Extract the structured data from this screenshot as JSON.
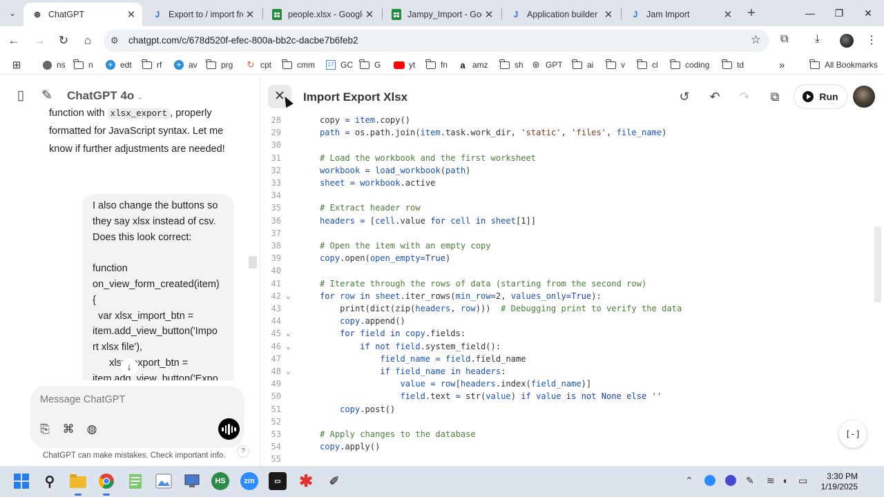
{
  "browser": {
    "tabs": [
      {
        "title": "ChatGPT",
        "icon": "chatgpt-icon",
        "active": true
      },
      {
        "title": "Export to / import fro",
        "icon": "jira-icon",
        "active": false
      },
      {
        "title": "people.xlsx - Google",
        "icon": "sheets-icon",
        "active": false
      },
      {
        "title": "Jampy_Import - Goo",
        "icon": "sheets-icon",
        "active": false
      },
      {
        "title": "Application builder",
        "icon": "jira-icon",
        "active": false
      },
      {
        "title": "Jam Import",
        "icon": "jira-icon",
        "active": false
      }
    ],
    "url": "chatgpt.com/c/678d520f-efec-800a-bb2c-dacbe7b6feb2",
    "bookmarks": [
      {
        "label": "ns",
        "icon": "globe-icon"
      },
      {
        "label": "n",
        "icon": "folder-icon"
      },
      {
        "label": "edt",
        "icon": "bird-icon"
      },
      {
        "label": "rf",
        "icon": "folder-icon"
      },
      {
        "label": "av",
        "icon": "bird-icon"
      },
      {
        "label": "prg",
        "icon": "folder-icon"
      },
      {
        "label": "cpt",
        "icon": "swirl-icon"
      },
      {
        "label": "cmm",
        "icon": "folder-icon"
      },
      {
        "label": "GC",
        "icon": "calendar-icon"
      },
      {
        "label": "G",
        "icon": "folder-icon"
      },
      {
        "label": "yt",
        "icon": "youtube-icon"
      },
      {
        "label": "fn",
        "icon": "folder-icon"
      },
      {
        "label": "amz",
        "icon": "amazon-icon"
      },
      {
        "label": "sh",
        "icon": "folder-icon"
      },
      {
        "label": "GPT",
        "icon": "chatgpt-icon"
      },
      {
        "label": "ai",
        "icon": "folder-icon"
      },
      {
        "label": "v",
        "icon": "folder-icon"
      },
      {
        "label": "cl",
        "icon": "folder-icon"
      },
      {
        "label": "coding",
        "icon": "folder-icon"
      },
      {
        "label": "td",
        "icon": "folder-icon"
      }
    ],
    "all_bookmarks": "All Bookmarks"
  },
  "chat": {
    "model": "ChatGPT 4o",
    "assistant_lines": [
      "function with `xlsx_export`, properly",
      "formatted for JavaScript syntax. Let me",
      "know if further adjustments are needed!"
    ],
    "assistant_line0_pre": "function with ",
    "assistant_line0_code": "xlsx_export",
    "assistant_line0_post": ", properly",
    "assistant_line1": "formatted for JavaScript syntax. Let me",
    "assistant_line2": "know if further adjustments are needed!",
    "user_message": "I also change the buttons so\nthey say xlsx instead of csv.\nDoes this look correct:\n\nfunction\non_view_form_created(item)\n{\n  var xlsx_import_btn =\nitem.add_view_button('Impo\nrt xlsx file'),\n      xlsx_export_btn =\nitem.add_view_button('Expo",
    "composer_placeholder": "Message ChatGPT",
    "disclaimer": "ChatGPT can make mistakes. Check important info.",
    "help": "?"
  },
  "canvas": {
    "title": "Import Export Xlsx",
    "run_label": "Run",
    "expr_label": "[-]"
  },
  "code_lines": [
    {
      "n": "28",
      "fold": "",
      "html": "copy <span class=\"kw\">=</span> <span class=\"nm\">item</span>.copy()"
    },
    {
      "n": "29",
      "fold": "",
      "html": "<span class=\"nm\">path</span> <span class=\"kw\">=</span> os.path.join(<span class=\"nm\">item</span>.task.work_dir, <span class=\"st\">'static'</span>, <span class=\"st\">'files'</span>, <span class=\"nm\">file_name</span>)"
    },
    {
      "n": "30",
      "fold": "",
      "html": ""
    },
    {
      "n": "31",
      "fold": "",
      "html": "<span class=\"cm\"># Load the workbook and the first worksheet</span>"
    },
    {
      "n": "32",
      "fold": "",
      "html": "<span class=\"nm\">workbook</span> <span class=\"kw\">=</span> <span class=\"nm\">load_workbook</span>(<span class=\"nm\">path</span>)"
    },
    {
      "n": "33",
      "fold": "",
      "html": "<span class=\"nm\">sheet</span> <span class=\"kw\">=</span> <span class=\"nm\">workbook</span>.active"
    },
    {
      "n": "34",
      "fold": "",
      "html": ""
    },
    {
      "n": "35",
      "fold": "",
      "html": "<span class=\"cm\"># Extract header row</span>"
    },
    {
      "n": "36",
      "fold": "",
      "html": "<span class=\"nm\">headers</span> <span class=\"kw\">=</span> [<span class=\"nm\">cell</span>.value <span class=\"kw\">for</span> <span class=\"nm\">cell</span> <span class=\"kw\">in</span> <span class=\"nm\">sheet</span>[1]]"
    },
    {
      "n": "37",
      "fold": "",
      "html": ""
    },
    {
      "n": "38",
      "fold": "",
      "html": "<span class=\"cm\"># Open the item with an empty copy</span>"
    },
    {
      "n": "39",
      "fold": "",
      "html": "<span class=\"nm\">copy</span>.open(<span class=\"nm\">open_empty</span><span class=\"kw\">=</span><span class=\"kw\">True</span>)"
    },
    {
      "n": "40",
      "fold": "",
      "html": ""
    },
    {
      "n": "41",
      "fold": "",
      "html": "<span class=\"cm\"># Iterate through the rows of data (starting from the second row)</span>"
    },
    {
      "n": "42",
      "fold": "⌄",
      "html": "<span class=\"kw\">for</span> <span class=\"nm\">row</span> <span class=\"kw\">in</span> <span class=\"nm\">sheet</span>.iter_rows(<span class=\"nm\">min_row</span><span class=\"kw\">=</span>2, <span class=\"nm\">values_only</span><span class=\"kw\">=</span><span class=\"kw\">True</span>):"
    },
    {
      "n": "43",
      "fold": "",
      "html": "    print(dict(zip(<span class=\"nm\">headers</span>, <span class=\"nm\">row</span>)))  <span class=\"cm\"># Debugging print to verify the data</span>"
    },
    {
      "n": "44",
      "fold": "",
      "html": "    <span class=\"nm\">copy</span>.append()"
    },
    {
      "n": "45",
      "fold": "⌄",
      "html": "    <span class=\"kw\">for</span> <span class=\"nm\">field</span> <span class=\"kw\">in</span> <span class=\"nm\">copy</span>.fields:"
    },
    {
      "n": "46",
      "fold": "⌄",
      "html": "        <span class=\"kw\">if</span> <span class=\"kw\">not</span> <span class=\"nm\">field</span>.system_field():"
    },
    {
      "n": "47",
      "fold": "",
      "html": "            <span class=\"nm\">field_name</span> <span class=\"kw\">=</span> <span class=\"nm\">field</span>.field_name"
    },
    {
      "n": "48",
      "fold": "⌄",
      "html": "            <span class=\"kw\">if</span> <span class=\"nm\">field_name</span> <span class=\"kw\">in</span> <span class=\"nm\">headers</span>:"
    },
    {
      "n": "49",
      "fold": "",
      "html": "                <span class=\"nm\">value</span> <span class=\"kw\">=</span> <span class=\"nm\">row</span>[<span class=\"nm\">headers</span>.index(<span class=\"nm\">field_name</span>)]"
    },
    {
      "n": "50",
      "fold": "",
      "html": "                <span class=\"nm\">field</span>.text <span class=\"kw\">=</span> str(<span class=\"nm\">value</span>) <span class=\"kw\">if</span> <span class=\"nm\">value</span> <span class=\"kw\">is not</span> <span class=\"kw\">None</span> <span class=\"kw\">else</span> <span class=\"st\">''</span>"
    },
    {
      "n": "51",
      "fold": "",
      "html": "    <span class=\"nm\">copy</span>.post()"
    },
    {
      "n": "52",
      "fold": "",
      "html": ""
    },
    {
      "n": "53",
      "fold": "",
      "html": "<span class=\"cm\"># Apply changes to the database</span>"
    },
    {
      "n": "54",
      "fold": "",
      "html": "<span class=\"nm\">copy</span>.apply()"
    },
    {
      "n": "55",
      "fold": "",
      "html": ""
    }
  ],
  "taskbar": {
    "apps": [
      "windows-start-icon",
      "search-icon",
      "file-explorer-icon",
      "chrome-icon",
      "notepad-icon",
      "image-viewer-icon",
      "remote-desktop-icon",
      "hs-icon",
      "zoom-icon",
      "terminal-icon",
      "asterisk-app-icon",
      "pen-tool-icon"
    ],
    "hs_label": "HS",
    "zm_label": "zm",
    "time": "3:30 PM",
    "date": "1/19/2025"
  },
  "colors": {
    "tabstrip": "#dfe3ea",
    "taskbar": "#dde3ec",
    "keyword": "#1c3da6",
    "comment": "#4b7d3a"
  }
}
